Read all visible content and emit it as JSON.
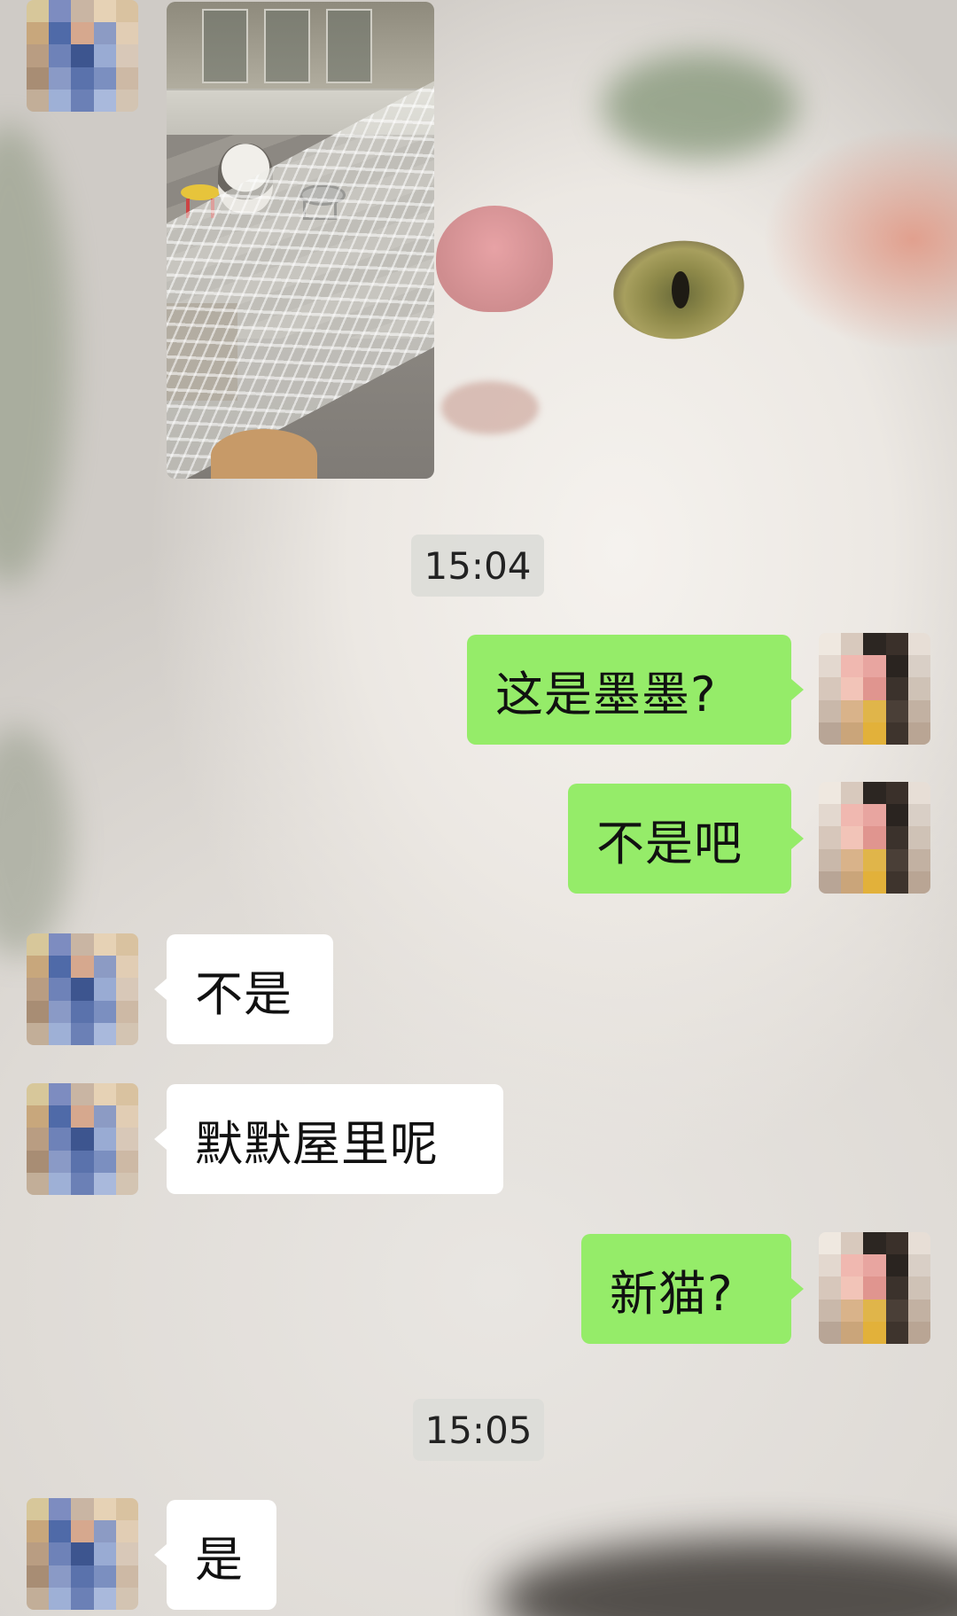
{
  "chat": {
    "timestamps": [
      "15:04",
      "15:05"
    ],
    "messages": [
      {
        "sender": "contact",
        "type": "image"
      },
      {
        "sender": "self",
        "type": "text",
        "text": "这是墨墨?"
      },
      {
        "sender": "self",
        "type": "text",
        "text": "不是吧"
      },
      {
        "sender": "contact",
        "type": "text",
        "text": "不是"
      },
      {
        "sender": "contact",
        "type": "text",
        "text": "默默屋里呢"
      },
      {
        "sender": "self",
        "type": "text",
        "text": "新猫?"
      },
      {
        "sender": "contact",
        "type": "text",
        "text": "是"
      }
    ]
  },
  "colors": {
    "incoming_bubble": "#ffffff",
    "outgoing_bubble": "#95ec69",
    "timestamp_bg": "#dcdcd8"
  }
}
